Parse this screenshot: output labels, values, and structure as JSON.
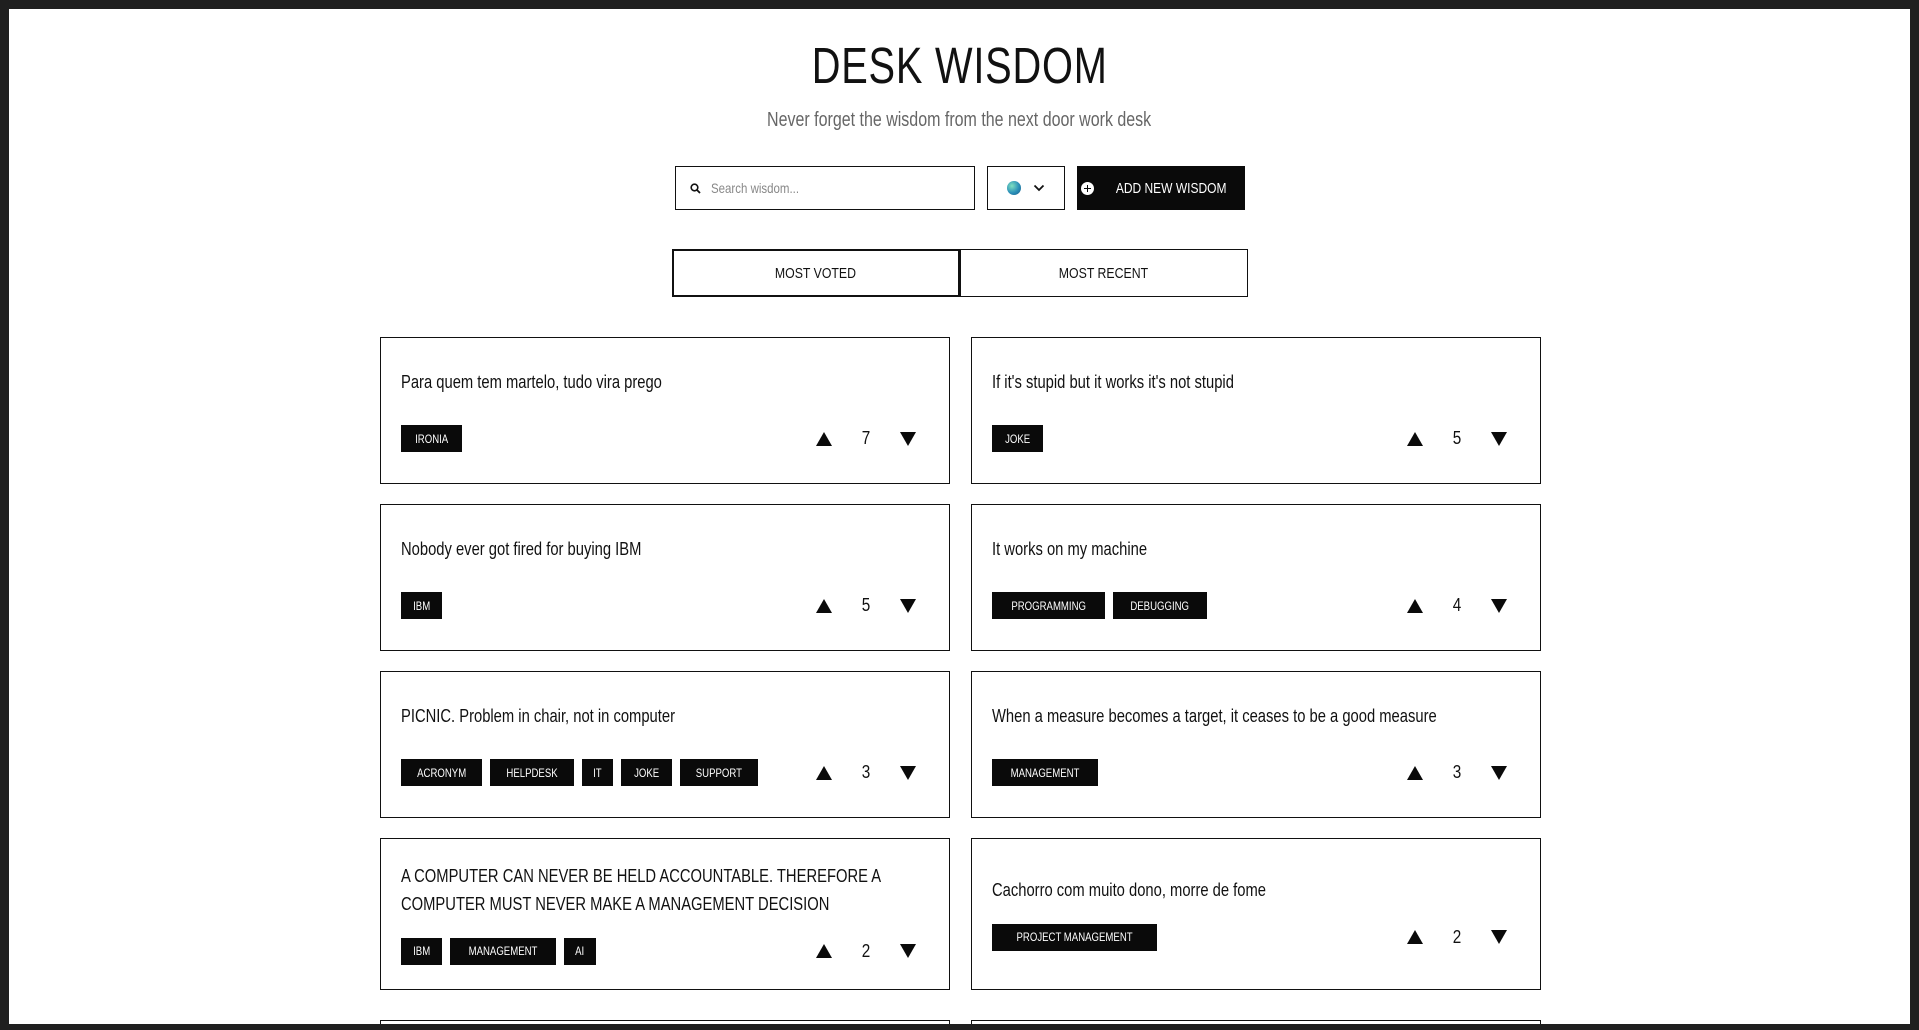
{
  "header": {
    "title": "DESK WISDOM",
    "subtitle": "Never forget the wisdom from the next door work desk"
  },
  "search": {
    "placeholder": "Search wisdom..."
  },
  "language": {
    "icon": "globe-icon"
  },
  "add_button": {
    "label": "ADD NEW WISDOM"
  },
  "tabs": [
    {
      "label": "MOST VOTED",
      "active": true
    },
    {
      "label": "MOST RECENT",
      "active": false
    }
  ],
  "cards": [
    {
      "quote": "Para quem tem martelo, tudo vira prego",
      "tags": [
        "IRONIA"
      ],
      "votes": "7"
    },
    {
      "quote": "If it's stupid but it works it's not stupid",
      "tags": [
        "JOKE"
      ],
      "votes": "5"
    },
    {
      "quote": "Nobody ever got fired for buying IBM",
      "tags": [
        "IBM"
      ],
      "votes": "5"
    },
    {
      "quote": "It works on my machine",
      "tags": [
        "PROGRAMMING",
        "DEBUGGING"
      ],
      "votes": "4"
    },
    {
      "quote": "PICNIC. Problem in chair, not in computer",
      "tags": [
        "ACRONYM",
        "HELPDESK",
        "IT",
        "JOKE",
        "SUPPORT"
      ],
      "votes": "3"
    },
    {
      "quote": "When a measure becomes a target, it ceases to be a good measure",
      "tags": [
        "MANAGEMENT"
      ],
      "votes": "3"
    },
    {
      "quote": "A COMPUTER CAN NEVER BE HELD ACCOUNTABLE. THEREFORE A COMPUTER MUST NEVER MAKE A MANAGEMENT DECISION",
      "tags": [
        "IBM",
        "MANAGEMENT",
        "AI"
      ],
      "votes": "2"
    },
    {
      "quote": "Cachorro com muito dono, morre de fome",
      "tags": [
        "PROJECT MANAGEMENT"
      ],
      "votes": "2"
    }
  ]
}
